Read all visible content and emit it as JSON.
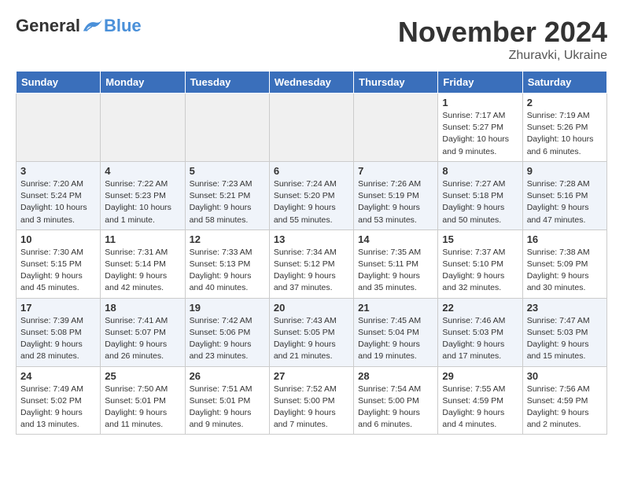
{
  "header": {
    "logo_general": "General",
    "logo_blue": "Blue",
    "month_title": "November 2024",
    "location": "Zhuravki, Ukraine"
  },
  "days_of_week": [
    "Sunday",
    "Monday",
    "Tuesday",
    "Wednesday",
    "Thursday",
    "Friday",
    "Saturday"
  ],
  "weeks": [
    {
      "days": [
        {
          "num": "",
          "info": ""
        },
        {
          "num": "",
          "info": ""
        },
        {
          "num": "",
          "info": ""
        },
        {
          "num": "",
          "info": ""
        },
        {
          "num": "",
          "info": ""
        },
        {
          "num": "1",
          "info": "Sunrise: 7:17 AM\nSunset: 5:27 PM\nDaylight: 10 hours and 9 minutes."
        },
        {
          "num": "2",
          "info": "Sunrise: 7:19 AM\nSunset: 5:26 PM\nDaylight: 10 hours and 6 minutes."
        }
      ]
    },
    {
      "days": [
        {
          "num": "3",
          "info": "Sunrise: 7:20 AM\nSunset: 5:24 PM\nDaylight: 10 hours and 3 minutes."
        },
        {
          "num": "4",
          "info": "Sunrise: 7:22 AM\nSunset: 5:23 PM\nDaylight: 10 hours and 1 minute."
        },
        {
          "num": "5",
          "info": "Sunrise: 7:23 AM\nSunset: 5:21 PM\nDaylight: 9 hours and 58 minutes."
        },
        {
          "num": "6",
          "info": "Sunrise: 7:24 AM\nSunset: 5:20 PM\nDaylight: 9 hours and 55 minutes."
        },
        {
          "num": "7",
          "info": "Sunrise: 7:26 AM\nSunset: 5:19 PM\nDaylight: 9 hours and 53 minutes."
        },
        {
          "num": "8",
          "info": "Sunrise: 7:27 AM\nSunset: 5:18 PM\nDaylight: 9 hours and 50 minutes."
        },
        {
          "num": "9",
          "info": "Sunrise: 7:28 AM\nSunset: 5:16 PM\nDaylight: 9 hours and 47 minutes."
        }
      ]
    },
    {
      "days": [
        {
          "num": "10",
          "info": "Sunrise: 7:30 AM\nSunset: 5:15 PM\nDaylight: 9 hours and 45 minutes."
        },
        {
          "num": "11",
          "info": "Sunrise: 7:31 AM\nSunset: 5:14 PM\nDaylight: 9 hours and 42 minutes."
        },
        {
          "num": "12",
          "info": "Sunrise: 7:33 AM\nSunset: 5:13 PM\nDaylight: 9 hours and 40 minutes."
        },
        {
          "num": "13",
          "info": "Sunrise: 7:34 AM\nSunset: 5:12 PM\nDaylight: 9 hours and 37 minutes."
        },
        {
          "num": "14",
          "info": "Sunrise: 7:35 AM\nSunset: 5:11 PM\nDaylight: 9 hours and 35 minutes."
        },
        {
          "num": "15",
          "info": "Sunrise: 7:37 AM\nSunset: 5:10 PM\nDaylight: 9 hours and 32 minutes."
        },
        {
          "num": "16",
          "info": "Sunrise: 7:38 AM\nSunset: 5:09 PM\nDaylight: 9 hours and 30 minutes."
        }
      ]
    },
    {
      "days": [
        {
          "num": "17",
          "info": "Sunrise: 7:39 AM\nSunset: 5:08 PM\nDaylight: 9 hours and 28 minutes."
        },
        {
          "num": "18",
          "info": "Sunrise: 7:41 AM\nSunset: 5:07 PM\nDaylight: 9 hours and 26 minutes."
        },
        {
          "num": "19",
          "info": "Sunrise: 7:42 AM\nSunset: 5:06 PM\nDaylight: 9 hours and 23 minutes."
        },
        {
          "num": "20",
          "info": "Sunrise: 7:43 AM\nSunset: 5:05 PM\nDaylight: 9 hours and 21 minutes."
        },
        {
          "num": "21",
          "info": "Sunrise: 7:45 AM\nSunset: 5:04 PM\nDaylight: 9 hours and 19 minutes."
        },
        {
          "num": "22",
          "info": "Sunrise: 7:46 AM\nSunset: 5:03 PM\nDaylight: 9 hours and 17 minutes."
        },
        {
          "num": "23",
          "info": "Sunrise: 7:47 AM\nSunset: 5:03 PM\nDaylight: 9 hours and 15 minutes."
        }
      ]
    },
    {
      "days": [
        {
          "num": "24",
          "info": "Sunrise: 7:49 AM\nSunset: 5:02 PM\nDaylight: 9 hours and 13 minutes."
        },
        {
          "num": "25",
          "info": "Sunrise: 7:50 AM\nSunset: 5:01 PM\nDaylight: 9 hours and 11 minutes."
        },
        {
          "num": "26",
          "info": "Sunrise: 7:51 AM\nSunset: 5:01 PM\nDaylight: 9 hours and 9 minutes."
        },
        {
          "num": "27",
          "info": "Sunrise: 7:52 AM\nSunset: 5:00 PM\nDaylight: 9 hours and 7 minutes."
        },
        {
          "num": "28",
          "info": "Sunrise: 7:54 AM\nSunset: 5:00 PM\nDaylight: 9 hours and 6 minutes."
        },
        {
          "num": "29",
          "info": "Sunrise: 7:55 AM\nSunset: 4:59 PM\nDaylight: 9 hours and 4 minutes."
        },
        {
          "num": "30",
          "info": "Sunrise: 7:56 AM\nSunset: 4:59 PM\nDaylight: 9 hours and 2 minutes."
        }
      ]
    }
  ]
}
